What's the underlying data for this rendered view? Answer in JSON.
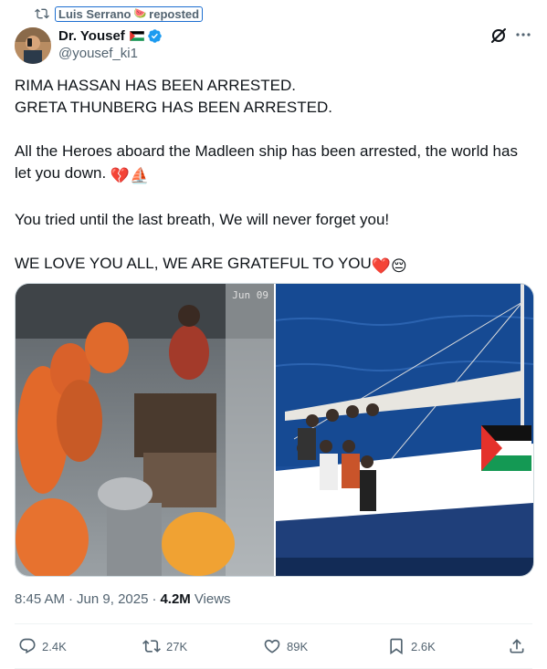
{
  "repost": {
    "name": "Luis Serrano",
    "emoji": "🍉",
    "label": "reposted"
  },
  "author": {
    "display_name": "Dr. Yousef",
    "handle": "@yousef_ki1"
  },
  "tweet": {
    "line1": "RIMA HASSAN HAS BEEN ARRESTED.",
    "line2": "GRETA THUNBERG HAS BEEN ARRESTED.",
    "line3": "All the Heroes aboard the Madleen ship has been arrested, the world has let you down.",
    "line3_emojis": "💔⛵",
    "line4": "You tried until the last breath, We will never forget you!",
    "line5": "WE LOVE YOU ALL, WE ARE GRATEFUL TO YOU",
    "line5_emojis": "❤️😔"
  },
  "media": {
    "left_timestamp": "Jun 09"
  },
  "meta": {
    "time": "8:45 AM",
    "date": "Jun 9, 2025",
    "views_count": "4.2M",
    "views_label": "Views"
  },
  "actions": {
    "replies": "2.4K",
    "reposts": "27K",
    "likes": "89K",
    "bookmarks": "2.6K"
  },
  "colors": {
    "repost_green": "#00ba7c",
    "verified_blue": "#1d9bf0",
    "text_primary": "#0f1419",
    "text_secondary": "#536471",
    "heart_red": "#e0245e"
  },
  "icons": [
    "repost-icon",
    "verified-icon",
    "grok-icon",
    "more-icon",
    "reply-icon",
    "retweet-icon",
    "like-icon",
    "bookmark-icon",
    "share-icon"
  ]
}
